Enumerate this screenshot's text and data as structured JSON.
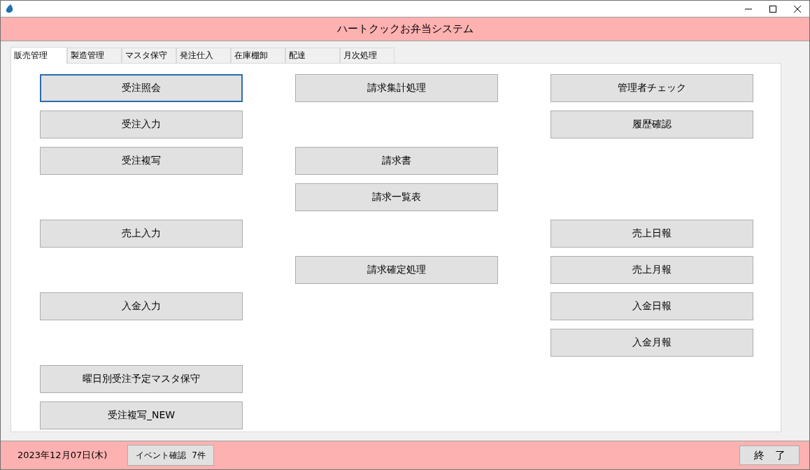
{
  "window": {
    "title": "ハートクックお弁当システム"
  },
  "tabs": [
    {
      "label": "販売管理",
      "selected": true
    },
    {
      "label": "製造管理",
      "selected": false
    },
    {
      "label": "マスタ保守",
      "selected": false
    },
    {
      "label": "発注仕入",
      "selected": false
    },
    {
      "label": "在庫棚卸",
      "selected": false
    },
    {
      "label": "配達",
      "selected": false
    },
    {
      "label": "月次処理",
      "selected": false
    }
  ],
  "columns": [
    [
      {
        "kind": "button",
        "label": "受注照会",
        "focused": true
      },
      {
        "kind": "button",
        "label": "受注入力",
        "focused": false
      },
      {
        "kind": "button",
        "label": "受注複写",
        "focused": false
      },
      {
        "kind": "spacer"
      },
      {
        "kind": "button",
        "label": "売上入力",
        "focused": false
      },
      {
        "kind": "spacer"
      },
      {
        "kind": "button",
        "label": "入金入力",
        "focused": false
      },
      {
        "kind": "spacer"
      },
      {
        "kind": "button",
        "label": "曜日別受注予定マスタ保守",
        "focused": false
      },
      {
        "kind": "button",
        "label": "受注複写_NEW",
        "focused": false
      }
    ],
    [
      {
        "kind": "button",
        "label": "請求集計処理",
        "focused": false
      },
      {
        "kind": "spacer"
      },
      {
        "kind": "button",
        "label": "請求書",
        "focused": false
      },
      {
        "kind": "button",
        "label": "請求一覧表",
        "focused": false
      },
      {
        "kind": "spacer"
      },
      {
        "kind": "button",
        "label": "請求確定処理",
        "focused": false
      }
    ],
    [
      {
        "kind": "button",
        "label": "管理者チェック",
        "focused": false
      },
      {
        "kind": "button",
        "label": "履歴確認",
        "focused": false
      },
      {
        "kind": "spacer"
      },
      {
        "kind": "spacer"
      },
      {
        "kind": "button",
        "label": "売上日報",
        "focused": false
      },
      {
        "kind": "button",
        "label": "売上月報",
        "focused": false
      },
      {
        "kind": "button",
        "label": "入金日報",
        "focused": false
      },
      {
        "kind": "button",
        "label": "入金月報",
        "focused": false
      }
    ]
  ],
  "footer": {
    "date": "2023年12月07日(木)",
    "event_button": {
      "label": "イベント確認",
      "count": "7件"
    },
    "exit_button": "終　了"
  }
}
